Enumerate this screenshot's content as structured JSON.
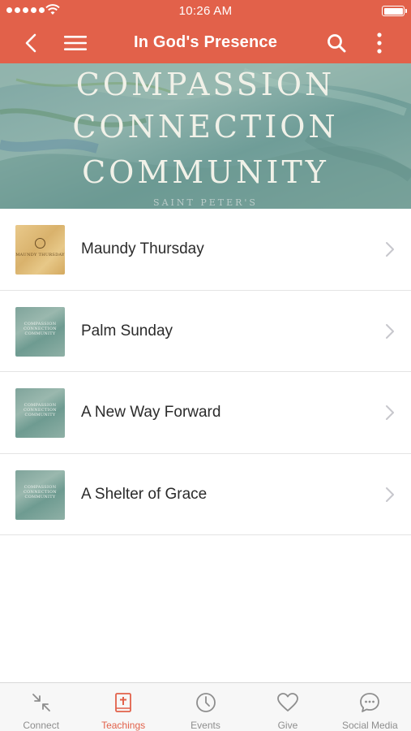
{
  "status_bar": {
    "time": "10:26 AM"
  },
  "nav": {
    "title": "In God's Presence",
    "icons": [
      "chevron-left-icon",
      "hamburger-menu-icon",
      "search-icon",
      "more-vertical-icon"
    ]
  },
  "banner": {
    "line1": "COMPASSION",
    "line2": "CONNECTION",
    "line3": "COMMUNITY",
    "caption": "SAINT PETER'S"
  },
  "list": {
    "items": [
      {
        "title": "Maundy Thursday",
        "thumb_text": "MAUNDY THURSDAY",
        "thumb_style": "gold"
      },
      {
        "title": "Palm Sunday",
        "thumb_text": "COMPASSION CONNECTION COMMUNITY",
        "thumb_style": "green"
      },
      {
        "title": "A New Way Forward",
        "thumb_text": "COMPASSION CONNECTION COMMUNITY",
        "thumb_style": "green"
      },
      {
        "title": "A Shelter of Grace",
        "thumb_text": "COMPASSION CONNECTION COMMUNITY",
        "thumb_style": "green"
      }
    ]
  },
  "tabs": [
    {
      "label": "Connect",
      "icon": "arrows-collapse-icon",
      "active": false
    },
    {
      "label": "Teachings",
      "icon": "bible-icon",
      "active": true
    },
    {
      "label": "Events",
      "icon": "clock-icon",
      "active": false
    },
    {
      "label": "Give",
      "icon": "heart-icon",
      "active": false
    },
    {
      "label": "Social Media",
      "icon": "chat-bubble-icon",
      "active": false
    }
  ],
  "colors": {
    "accent": "#e2614a",
    "tab_inactive": "#8e8e8e",
    "text": "#2b2b2b"
  }
}
